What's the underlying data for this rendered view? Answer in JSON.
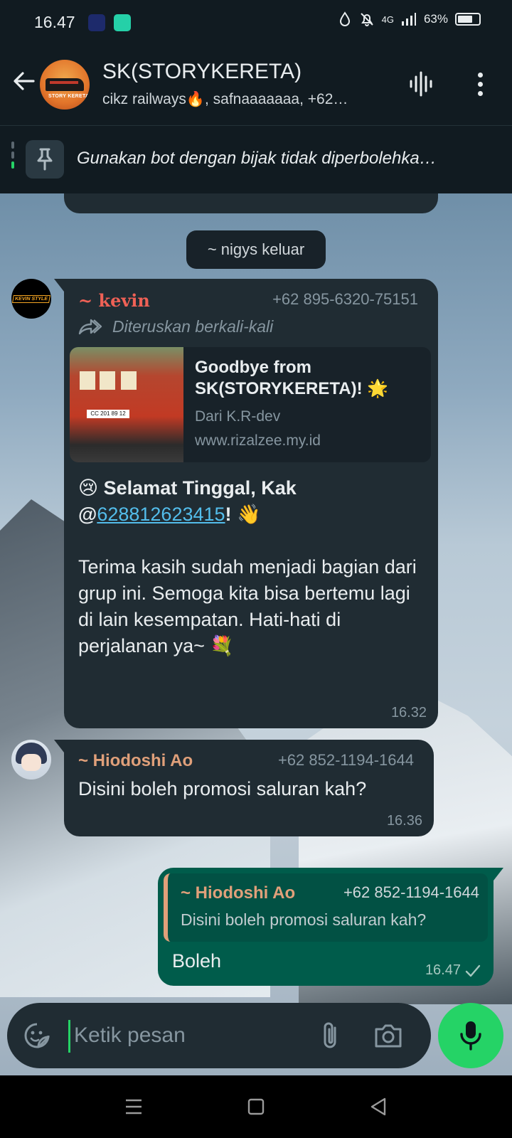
{
  "status_bar": {
    "time": "16.47",
    "network": "4G",
    "battery": "63%"
  },
  "header": {
    "title": "SK(STORYKERETA)",
    "members": "cikz railways🔥, safnaaaaaaa, +62…",
    "avatar_text": "STORY KERETA"
  },
  "pinned": {
    "text": "Gunakan bot dengan bijak tidak diperbolehka…"
  },
  "system_message": "~ nigys keluar",
  "messages": {
    "kevin": {
      "sender": "~ kevin",
      "phone": "+62 895-6320-75151",
      "forwarded_label": "Diteruskan berkali-kali",
      "preview": {
        "title": "Goodbye from SK(STORYKERETA)! 🌟",
        "from": "Dari K.R-dev",
        "url": "www.rizalzee.my.id",
        "plate": "CC 201 89 12"
      },
      "headline": "😢 Selamat Tinggal, Kak",
      "mention_prefix": "@",
      "mention": "628812623415",
      "mention_suffix": "! 👋",
      "body": "Terima kasih sudah menjadi bagian dari grup ini. Semoga kita bisa bertemu lagi di lain kesempatan. Hati-hati di perjalanan ya~ 💐",
      "time": "16.32",
      "avatar_text": "KEVIN STYLE"
    },
    "ao": {
      "sender": "~ Hiodoshi Ao",
      "phone": "+62 852-1194-1644",
      "text": "Disini boleh promosi saluran kah?",
      "time": "16.36"
    },
    "me": {
      "quote_sender": "~ Hiodoshi Ao",
      "quote_phone": "+62 852-1194-1644",
      "quote_text": "Disini boleh promosi saluran kah?",
      "text": "Boleh",
      "time": "16.47",
      "status_icon": "single-check-icon"
    }
  },
  "input": {
    "placeholder": "Ketik pesan"
  },
  "colors": {
    "accent": "#25d366",
    "bubble_in": "#202c33",
    "bubble_out": "#005c4b",
    "kevin_name": "#ef6156",
    "ao_name": "#e0a07a",
    "mention": "#53bdeb"
  }
}
